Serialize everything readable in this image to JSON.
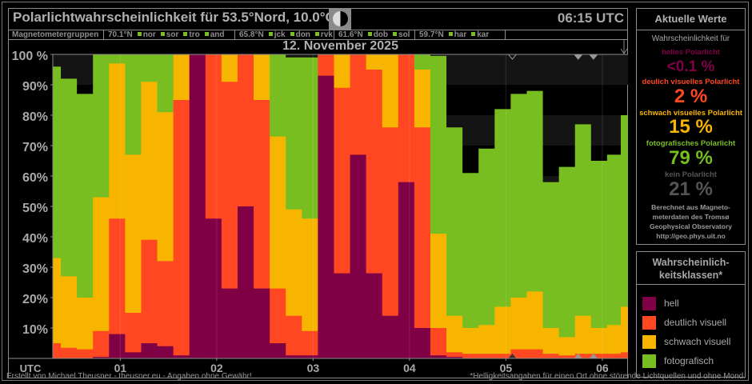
{
  "header": {
    "title": "Polarlichtwahrscheinlichkeit für  53.5°Nord, 10.0°Ost",
    "clock": "06:15 UTC",
    "moon_icon": "moon-phase-icon"
  },
  "magnetometers": {
    "label": "Magnetometergruppen",
    "groups": [
      {
        "lat": "70.1°N",
        "stations": [
          "nor",
          "sor",
          "tro",
          "and"
        ]
      },
      {
        "lat": "65.8°N",
        "stations": [
          "jck",
          "don",
          "rvk"
        ]
      },
      {
        "lat": "61.6°N",
        "stations": [
          "dob",
          "sol"
        ]
      },
      {
        "lat": "59.7°N",
        "stations": [
          "har",
          "kar"
        ]
      }
    ]
  },
  "current": {
    "heading": "Aktuelle Werte",
    "intro": "Wahrscheinlichkeit für",
    "hell_label": "helles Polarlicht",
    "hell_value": "<0.1 %",
    "deutlich_label": "deulich visuelles Polarlicht",
    "deutlich_value": "2 %",
    "schwach_label": "schwach visuelles Polarlicht",
    "schwach_value": "15 %",
    "foto_label": "fotografisches Polarlicht",
    "foto_value": "79 %",
    "kein_label": "kein Polarlicht",
    "kein_value": "21 %",
    "note": [
      "Berechnet aus Magneto-",
      "meterdaten des Tromsø",
      "Geophysical Observatory",
      "http://geo.phys.uit.no"
    ]
  },
  "legend": {
    "heading_1": "Wahrscheinlich-",
    "heading_2": "keitsklassen*",
    "items": [
      {
        "label": "hell",
        "color": "#800046"
      },
      {
        "label": "deutlich visuell",
        "color": "#ff4822"
      },
      {
        "label": "schwach visuell",
        "color": "#f8b500"
      },
      {
        "label": "fotografisch",
        "color": "#78be20"
      }
    ]
  },
  "footer": {
    "left": "Erstellt von Michael Theusner - theusner.eu - Angaben ohne Gewähr!",
    "right": "*Helligkeitsangaben für einen Ort ohne störende Lichtquellen und ohne Mond."
  },
  "chart_data": {
    "type": "area",
    "title": "12. November 2025",
    "xlabel": "UTC",
    "ylabel": "",
    "stacking": "cumulative",
    "x_unit": "minutes after 00:00 UTC",
    "xlim": [
      18,
      376
    ],
    "ylim": [
      0,
      100
    ],
    "x_ticks": [
      {
        "value": 60,
        "label": "01"
      },
      {
        "value": 120,
        "label": "02"
      },
      {
        "value": 180,
        "label": "03"
      },
      {
        "value": 240,
        "label": "04"
      },
      {
        "value": 300,
        "label": "05"
      },
      {
        "value": 360,
        "label": "06"
      }
    ],
    "y_ticks": [
      {
        "value": 10,
        "label": "10%"
      },
      {
        "value": 20,
        "label": "20%"
      },
      {
        "value": 30,
        "label": "30%"
      },
      {
        "value": 40,
        "label": "40%"
      },
      {
        "value": 50,
        "label": "50%"
      },
      {
        "value": 60,
        "label": "60%"
      },
      {
        "value": 70,
        "label": "70%"
      },
      {
        "value": 80,
        "label": "80%"
      },
      {
        "value": 90,
        "label": "90%"
      },
      {
        "value": 100,
        "label": "100 %"
      }
    ],
    "x": [
      18,
      28,
      38,
      48,
      58,
      68,
      78,
      88,
      98,
      108,
      118,
      128,
      138,
      148,
      158,
      168,
      178,
      188,
      198,
      208,
      218,
      228,
      238,
      248,
      258,
      268,
      278,
      288,
      298,
      308,
      318,
      328,
      338,
      348,
      358,
      368,
      375
    ],
    "series": [
      {
        "name": "fotografisch",
        "color": "#78be20",
        "values": [
          96,
          92,
          87,
          100,
          100,
          100,
          100,
          100,
          100,
          100,
          100,
          100,
          100,
          100,
          100,
          99,
          99,
          100,
          100,
          100,
          100,
          100,
          100,
          100,
          99.5,
          76,
          61,
          69,
          82,
          87,
          88,
          58,
          63,
          77,
          65,
          67,
          80
        ]
      },
      {
        "name": "schwach visuell",
        "color": "#f8b500",
        "values": [
          33,
          27,
          20,
          53,
          97,
          67,
          91,
          81,
          100,
          100,
          100,
          100,
          100,
          100,
          73,
          49,
          46,
          100,
          100,
          100,
          100,
          100,
          100,
          95,
          41,
          14,
          10,
          11,
          17,
          20,
          22,
          10,
          7,
          14,
          10,
          11,
          17
        ]
      },
      {
        "name": "deutlich visuell",
        "color": "#ff4822",
        "values": [
          5,
          3.5,
          3,
          9,
          46,
          15,
          39,
          32,
          85,
          100,
          100,
          91,
          100,
          85,
          23,
          14,
          9,
          100,
          89,
          100,
          95,
          76,
          100,
          76,
          10,
          2,
          1.5,
          1.5,
          1.5,
          3,
          3,
          1.5,
          1,
          1.5,
          1.5,
          1.5,
          2
        ]
      },
      {
        "name": "hell",
        "color": "#800046",
        "values": [
          0,
          0,
          0,
          0.5,
          8,
          2,
          5,
          4,
          1,
          100,
          46,
          23,
          50,
          23,
          5,
          1,
          1,
          93,
          28,
          67,
          28,
          14,
          58,
          10,
          1,
          0.5,
          0,
          0,
          0,
          0,
          0,
          0,
          0,
          0,
          0,
          0,
          0
        ]
      }
    ]
  }
}
